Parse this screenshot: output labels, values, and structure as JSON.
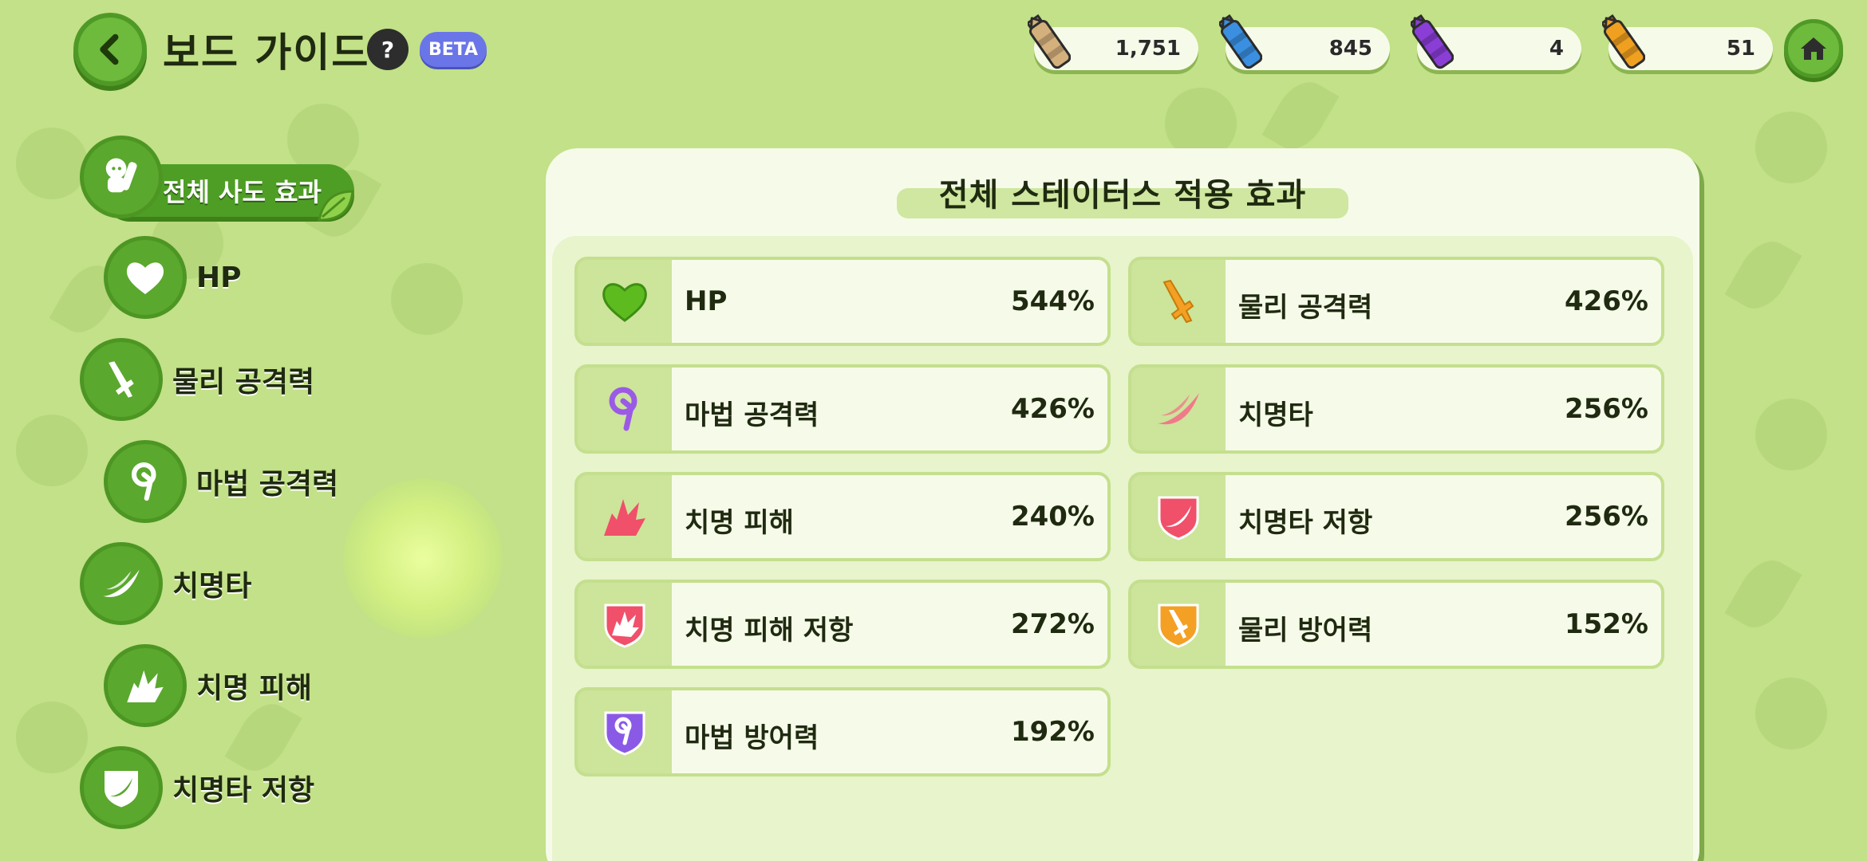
{
  "header": {
    "title": "보드 가이드",
    "help_glyph": "?",
    "beta_label": "BETA"
  },
  "currencies": [
    {
      "icon": "beige-crayon-icon",
      "color": "#d4b07c",
      "amount": "1,751"
    },
    {
      "icon": "blue-crayon-icon",
      "color": "#3a8fe0",
      "amount": "845"
    },
    {
      "icon": "purple-crayon-icon",
      "color": "#8a3ed6",
      "amount": "4"
    },
    {
      "icon": "orange-crayon-icon",
      "color": "#f0a020",
      "amount": "51"
    }
  ],
  "sidebar": {
    "active_label": "전체 사도 효과",
    "items": [
      {
        "icon": "heart-icon",
        "label": "HP"
      },
      {
        "icon": "sword-icon",
        "label": "물리 공격력"
      },
      {
        "icon": "wand-icon",
        "label": "마법 공격력"
      },
      {
        "icon": "slash-icon",
        "label": "치명타"
      },
      {
        "icon": "burst-icon",
        "label": "치명 피해"
      },
      {
        "icon": "shield-slash-icon",
        "label": "치명타 저항"
      }
    ]
  },
  "panel": {
    "title": "전체 스테이터스 적용 효과",
    "stats": [
      {
        "icon": "heart-icon",
        "name": "HP",
        "value": "544%",
        "color": "#5dbb1f"
      },
      {
        "icon": "sword-icon",
        "name": "물리 공격력",
        "value": "426%",
        "color": "#f3a024"
      },
      {
        "icon": "wand-icon",
        "name": "마법 공격력",
        "value": "426%",
        "color": "#9b5ae6"
      },
      {
        "icon": "slash-icon",
        "name": "치명타",
        "value": "256%",
        "color": "#f07a8a"
      },
      {
        "icon": "burst-icon",
        "name": "치명 피해",
        "value": "240%",
        "color": "#f0506a"
      },
      {
        "icon": "shield-slash-icon",
        "name": "치명타 저항",
        "value": "256%",
        "color": "#f0506a"
      },
      {
        "icon": "shield-burst-icon",
        "name": "치명 피해 저항",
        "value": "272%",
        "color": "#f0506a"
      },
      {
        "icon": "shield-sword-icon",
        "name": "물리 방어력",
        "value": "152%",
        "color": "#f3a024"
      },
      {
        "icon": "shield-wand-icon",
        "name": "마법 방어력",
        "value": "192%",
        "color": "#8a5ae6"
      }
    ]
  }
}
